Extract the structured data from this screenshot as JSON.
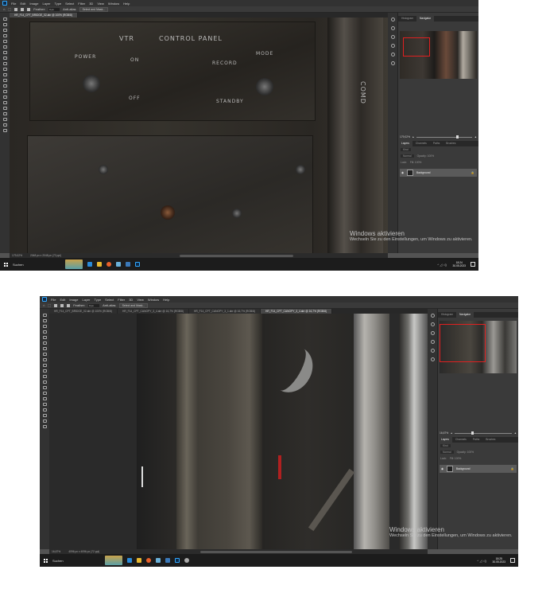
{
  "menu": [
    "File",
    "Edit",
    "Image",
    "Layer",
    "Type",
    "Select",
    "Filter",
    "3D",
    "View",
    "Window",
    "Help"
  ],
  "options": {
    "feather_label": "Feather:",
    "feather_value": "0 px",
    "antialias": "Anti-alias",
    "select_mask": "Select and Mask..."
  },
  "panels": {
    "tabs_top": [
      "Histogram",
      "Navigator"
    ],
    "tabs_layers": [
      "Layers",
      "Channels",
      "Paths",
      "Brushes"
    ],
    "kind": "Kind",
    "blend": "Normal",
    "opacity": "Opacity: 100%",
    "lock": "Lock:",
    "fill": "Fill: 100%",
    "layer_name": "Background"
  },
  "activation": {
    "title": "Windows aktivieren",
    "subtitle": "Wechseln Sie zu den Einstellungen, um Windows zu aktivieren."
  },
  "taskbar": {
    "search": "Suchen",
    "date": "30.05.2023"
  },
  "windows": [
    {
      "tabs": [
        "HR_F14_CPT_BRIDGE_02.abr @ 100% (RGB/8)"
      ],
      "zoom": "179,02%",
      "zoom_fraction": 0.72,
      "status_zoom": "179,02%",
      "status_size": "2048 px x 2048 px (72 ppi)",
      "time": "18:24",
      "canvas_labels": [
        "VTR",
        "CONTROL PANEL",
        "POWER",
        "ON",
        "OFF",
        "RECORD",
        "MODE",
        "STANDBY",
        "COMD"
      ]
    },
    {
      "tabs": [
        "HR_F14_CPT_BRIDGE_02.abr @ 100% (RGB/8)",
        "HR_F14_CPT_CANOPY_3_4.abr @ 16,7% (RGB/8)",
        "HR_F14_CPT_CANOPY_3_1.abr @ 16,7% (RGB/8)",
        "HR_F14_CPT_CANOPY_3_4.abr @ 16,7% (RGB/8)"
      ],
      "zoom": "16,67%",
      "zoom_fraction": 0.3,
      "status_zoom": "16,67%",
      "status_size": "4096 px x 4096 px (72 ppi)",
      "time": "18:25"
    }
  ],
  "colors": {
    "accent": "#31a8ff",
    "nav_box": "#e02020"
  }
}
